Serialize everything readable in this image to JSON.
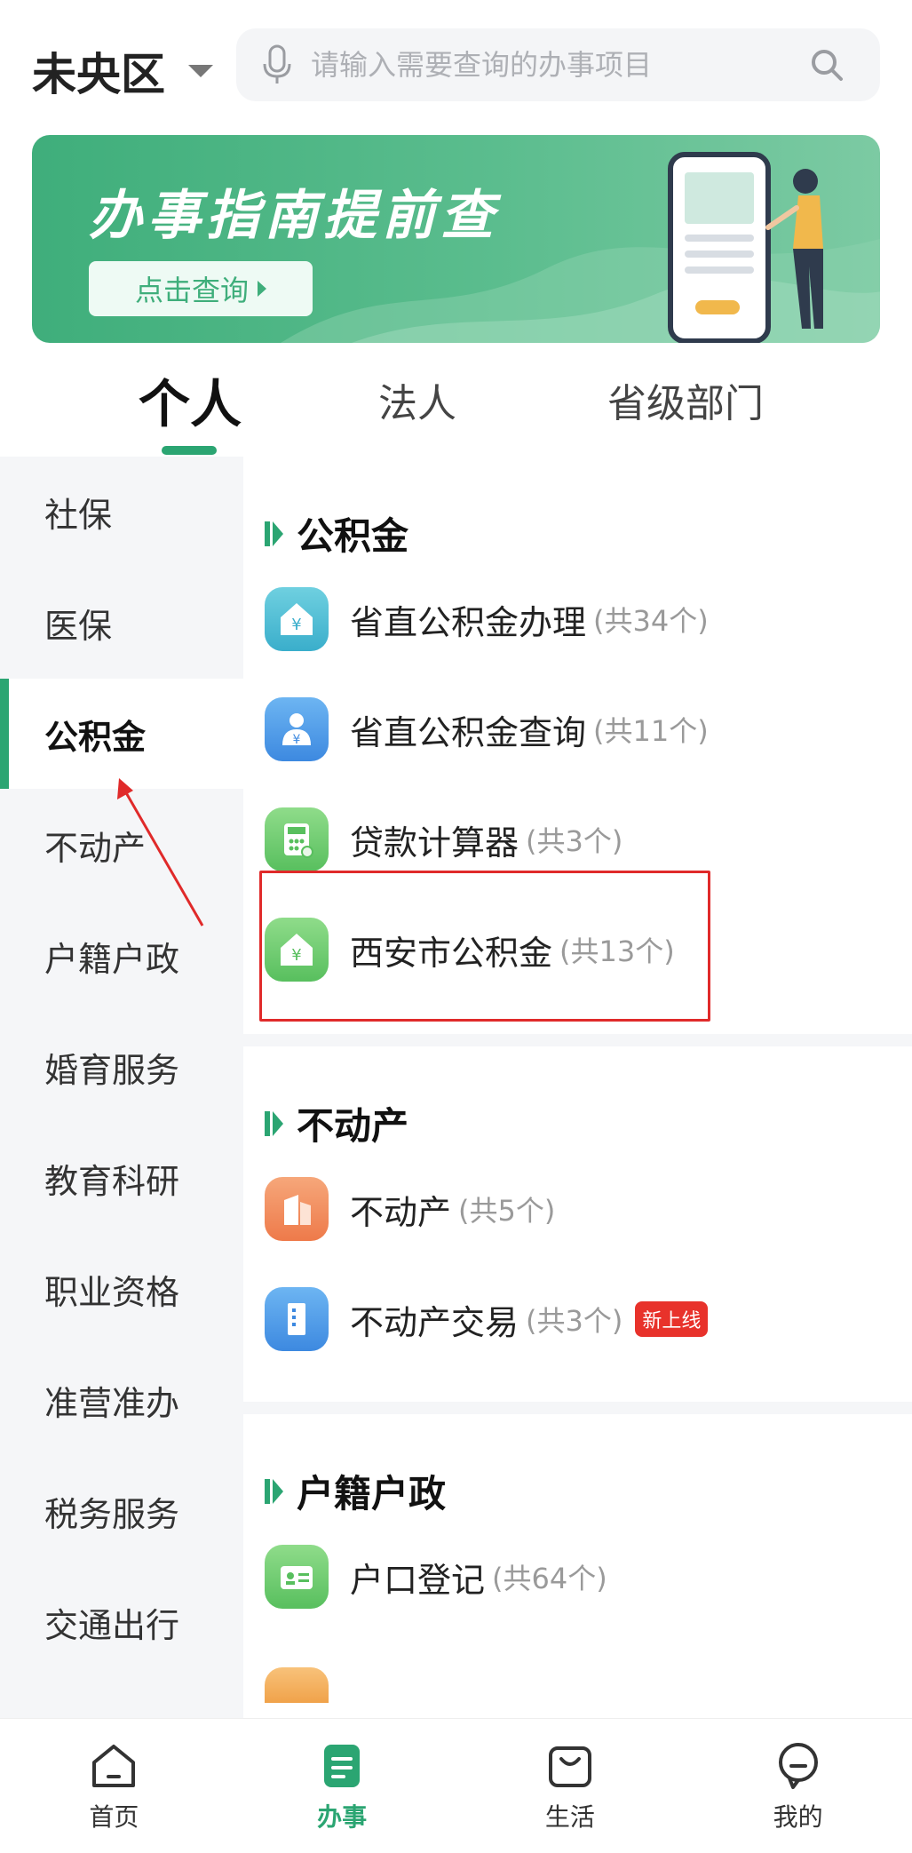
{
  "header": {
    "district": "未央区",
    "search_placeholder": "请输入需要查询的办事项目"
  },
  "banner": {
    "title": "办事指南提前查",
    "button_label": "点击查询"
  },
  "tabs": [
    {
      "label": "个人",
      "active": true
    },
    {
      "label": "法人",
      "active": false
    },
    {
      "label": "省级部门",
      "active": false
    }
  ],
  "sidebar": {
    "items": [
      {
        "label": "社保"
      },
      {
        "label": "医保"
      },
      {
        "label": "公积金",
        "active": true
      },
      {
        "label": "不动产"
      },
      {
        "label": "户籍户政"
      },
      {
        "label": "婚育服务"
      },
      {
        "label": "教育科研"
      },
      {
        "label": "职业资格"
      },
      {
        "label": "准营准办"
      },
      {
        "label": "税务服务"
      },
      {
        "label": "交通出行"
      }
    ]
  },
  "sections": [
    {
      "title": "公积金",
      "items": [
        {
          "label": "省直公积金办理",
          "count": "(共34个)",
          "icon": "house-yuan-icon"
        },
        {
          "label": "省直公积金查询",
          "count": "(共11个)",
          "icon": "person-yuan-icon"
        },
        {
          "label": "贷款计算器",
          "count": "(共3个)",
          "icon": "calculator-icon"
        },
        {
          "label": "西安市公积金",
          "count": "(共13个)",
          "icon": "house-yuan-icon"
        }
      ]
    },
    {
      "title": "不动产",
      "items": [
        {
          "label": "不动产",
          "count": "(共5个)",
          "icon": "building-icon"
        },
        {
          "label": "不动产交易",
          "count": "(共3个)",
          "badge": "新上线",
          "icon": "door-icon"
        }
      ]
    },
    {
      "title": "户籍户政",
      "items": [
        {
          "label": "户口登记",
          "count": "(共64个)",
          "icon": "id-card-icon"
        }
      ]
    }
  ],
  "bottom_nav": [
    {
      "label": "首页",
      "icon": "home-icon"
    },
    {
      "label": "办事",
      "icon": "document-icon",
      "active": true
    },
    {
      "label": "生活",
      "icon": "bag-icon"
    },
    {
      "label": "我的",
      "icon": "profile-icon"
    }
  ],
  "colors": {
    "accent": "#2ba572",
    "annotation_red": "#e02a2a",
    "badge_red": "#e8322b"
  }
}
